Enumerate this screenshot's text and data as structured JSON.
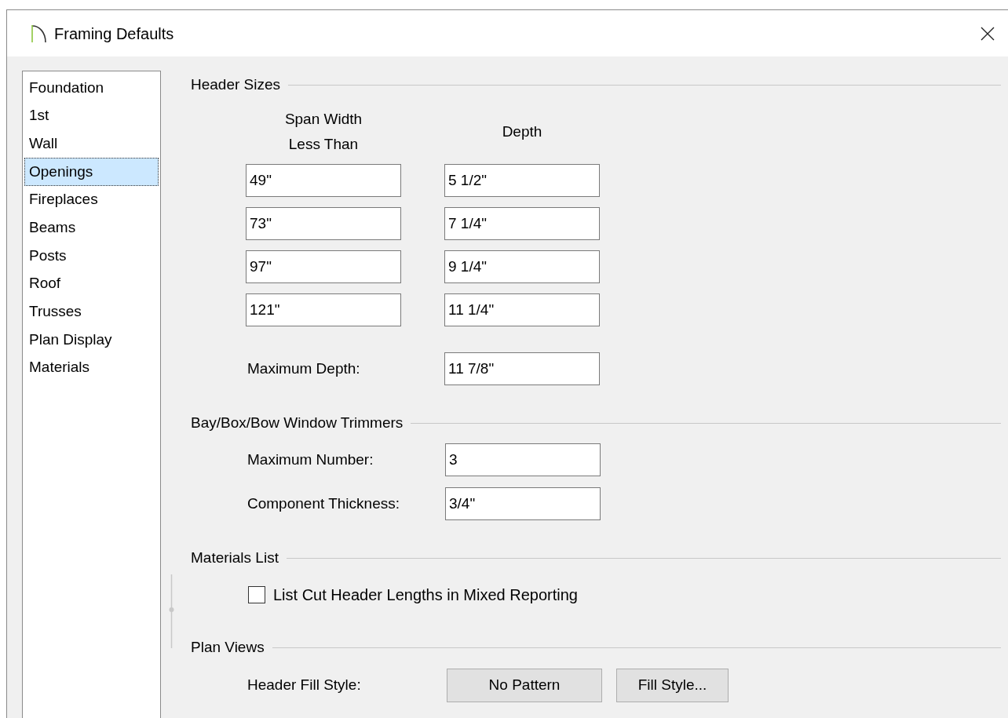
{
  "window": {
    "title": "Framing Defaults"
  },
  "sidebar": {
    "items": [
      {
        "label": "Foundation",
        "selected": false
      },
      {
        "label": "1st",
        "selected": false
      },
      {
        "label": "Wall",
        "selected": false
      },
      {
        "label": "Openings",
        "selected": true
      },
      {
        "label": "Fireplaces",
        "selected": false
      },
      {
        "label": "Beams",
        "selected": false
      },
      {
        "label": "Posts",
        "selected": false
      },
      {
        "label": "Roof",
        "selected": false
      },
      {
        "label": "Trusses",
        "selected": false
      },
      {
        "label": "Plan Display",
        "selected": false
      },
      {
        "label": "Materials",
        "selected": false
      }
    ]
  },
  "header_sizes": {
    "title": "Header Sizes",
    "columns": [
      "Span Width Less Than",
      "Depth"
    ],
    "rows": [
      {
        "span": "49\"",
        "depth": "5 1/2\""
      },
      {
        "span": "73\"",
        "depth": "7 1/4\""
      },
      {
        "span": "97\"",
        "depth": "9 1/4\""
      },
      {
        "span": "121\"",
        "depth": "11 1/4\""
      }
    ],
    "maximum_depth": {
      "label": "Maximum Depth:",
      "value": "11 7/8\""
    }
  },
  "bay_trimmers": {
    "title": "Bay/Box/Bow Window Trimmers",
    "fields": [
      {
        "label": "Maximum Number:",
        "value": "3"
      },
      {
        "label": "Component Thickness:",
        "value": "3/4\""
      }
    ]
  },
  "materials_list": {
    "title": "Materials List",
    "checkbox": {
      "label": "List Cut Header Lengths in Mixed Reporting",
      "checked": false
    }
  },
  "plan_views": {
    "title": "Plan Views",
    "header_fill_style": {
      "label": "Header Fill Style:",
      "pattern": "No Pattern",
      "button": "Fill Style..."
    }
  }
}
